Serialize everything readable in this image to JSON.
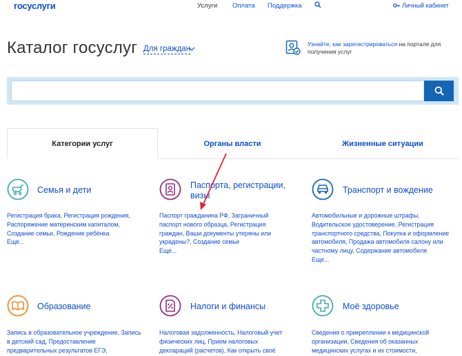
{
  "header": {
    "logo_part1": "госуслуги",
    "logo_part2": "",
    "nav": [
      {
        "label": "Услуги"
      },
      {
        "label": "Оплата"
      },
      {
        "label": "Поддержка"
      }
    ],
    "cabinet_label": "Личный кабинет"
  },
  "main": {
    "title": "Каталог госуслуг",
    "audience_label": "Для граждан",
    "register_link": "Узнайте, как зарегистрироваться",
    "register_rest": " на портале для получения услуг",
    "search": {
      "placeholder": "",
      "value": ""
    }
  },
  "tabs": [
    {
      "label": "Категории услуг"
    },
    {
      "label": "Органы власти"
    },
    {
      "label": "Жизненные ситуации"
    }
  ],
  "categories": [
    {
      "title": "Семья и дети",
      "desc": "Регистрация брака, Регистрация рождения, Распоряжение материнским капиталом, Создание семьи, Рождение ребёнка\nЕще..."
    },
    {
      "title": "Паспорта, регистрации, визы",
      "desc": "Паспорт гражданина РФ, Заграничный паспорт нового образца, Регистрация граждан, Ваши документы утеряны или украдены?, Создание семьи\nЕще..."
    },
    {
      "title": "Транспорт и вождение",
      "desc": "Автомобильные и дорожные штрафы, Водительское удостоверение, Регистрация транспортного средства, Покупка и оформление автомобиля, Продажа автомобиля салону или частному лицу, Содержание автомобиля\nЕще..."
    },
    {
      "title": "Образование",
      "desc": "Запись в образовательное учреждение, Запись в детский сад, Предоставление предварительных результатов ЕГЭ,"
    },
    {
      "title": "Налоги и финансы",
      "desc": "Налоговая задолженность, Налоговый учет физических лиц, Прием налоговых деклараций (расчетов), Как открыть своё"
    },
    {
      "title": "Моё здоровье",
      "desc": "Сведения о прикреплении к медицинской организации, Сведения об оказанных медицинских услугах и их стоимости,"
    }
  ],
  "colors": {
    "brand_blue": "#0d4cd3",
    "search_band": "#cfe6f7",
    "accent_red": "#e5212d",
    "teal_icon": "#3fa9b5",
    "orange_icon": "#f08a2c",
    "purple_icon": "#9a2c7e"
  }
}
